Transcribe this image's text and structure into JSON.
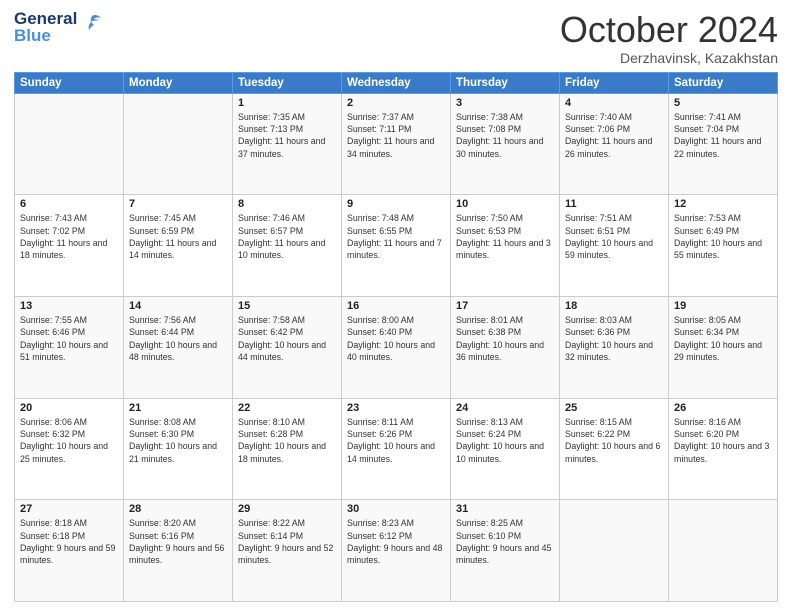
{
  "header": {
    "logo_line1": "General",
    "logo_line2": "Blue",
    "month_title": "October 2024",
    "location": "Derzhavinsk, Kazakhstan"
  },
  "weekdays": [
    "Sunday",
    "Monday",
    "Tuesday",
    "Wednesday",
    "Thursday",
    "Friday",
    "Saturday"
  ],
  "weeks": [
    [
      {
        "day": "",
        "info": ""
      },
      {
        "day": "",
        "info": ""
      },
      {
        "day": "1",
        "info": "Sunrise: 7:35 AM\nSunset: 7:13 PM\nDaylight: 11 hours and 37 minutes."
      },
      {
        "day": "2",
        "info": "Sunrise: 7:37 AM\nSunset: 7:11 PM\nDaylight: 11 hours and 34 minutes."
      },
      {
        "day": "3",
        "info": "Sunrise: 7:38 AM\nSunset: 7:08 PM\nDaylight: 11 hours and 30 minutes."
      },
      {
        "day": "4",
        "info": "Sunrise: 7:40 AM\nSunset: 7:06 PM\nDaylight: 11 hours and 26 minutes."
      },
      {
        "day": "5",
        "info": "Sunrise: 7:41 AM\nSunset: 7:04 PM\nDaylight: 11 hours and 22 minutes."
      }
    ],
    [
      {
        "day": "6",
        "info": "Sunrise: 7:43 AM\nSunset: 7:02 PM\nDaylight: 11 hours and 18 minutes."
      },
      {
        "day": "7",
        "info": "Sunrise: 7:45 AM\nSunset: 6:59 PM\nDaylight: 11 hours and 14 minutes."
      },
      {
        "day": "8",
        "info": "Sunrise: 7:46 AM\nSunset: 6:57 PM\nDaylight: 11 hours and 10 minutes."
      },
      {
        "day": "9",
        "info": "Sunrise: 7:48 AM\nSunset: 6:55 PM\nDaylight: 11 hours and 7 minutes."
      },
      {
        "day": "10",
        "info": "Sunrise: 7:50 AM\nSunset: 6:53 PM\nDaylight: 11 hours and 3 minutes."
      },
      {
        "day": "11",
        "info": "Sunrise: 7:51 AM\nSunset: 6:51 PM\nDaylight: 10 hours and 59 minutes."
      },
      {
        "day": "12",
        "info": "Sunrise: 7:53 AM\nSunset: 6:49 PM\nDaylight: 10 hours and 55 minutes."
      }
    ],
    [
      {
        "day": "13",
        "info": "Sunrise: 7:55 AM\nSunset: 6:46 PM\nDaylight: 10 hours and 51 minutes."
      },
      {
        "day": "14",
        "info": "Sunrise: 7:56 AM\nSunset: 6:44 PM\nDaylight: 10 hours and 48 minutes."
      },
      {
        "day": "15",
        "info": "Sunrise: 7:58 AM\nSunset: 6:42 PM\nDaylight: 10 hours and 44 minutes."
      },
      {
        "day": "16",
        "info": "Sunrise: 8:00 AM\nSunset: 6:40 PM\nDaylight: 10 hours and 40 minutes."
      },
      {
        "day": "17",
        "info": "Sunrise: 8:01 AM\nSunset: 6:38 PM\nDaylight: 10 hours and 36 minutes."
      },
      {
        "day": "18",
        "info": "Sunrise: 8:03 AM\nSunset: 6:36 PM\nDaylight: 10 hours and 32 minutes."
      },
      {
        "day": "19",
        "info": "Sunrise: 8:05 AM\nSunset: 6:34 PM\nDaylight: 10 hours and 29 minutes."
      }
    ],
    [
      {
        "day": "20",
        "info": "Sunrise: 8:06 AM\nSunset: 6:32 PM\nDaylight: 10 hours and 25 minutes."
      },
      {
        "day": "21",
        "info": "Sunrise: 8:08 AM\nSunset: 6:30 PM\nDaylight: 10 hours and 21 minutes."
      },
      {
        "day": "22",
        "info": "Sunrise: 8:10 AM\nSunset: 6:28 PM\nDaylight: 10 hours and 18 minutes."
      },
      {
        "day": "23",
        "info": "Sunrise: 8:11 AM\nSunset: 6:26 PM\nDaylight: 10 hours and 14 minutes."
      },
      {
        "day": "24",
        "info": "Sunrise: 8:13 AM\nSunset: 6:24 PM\nDaylight: 10 hours and 10 minutes."
      },
      {
        "day": "25",
        "info": "Sunrise: 8:15 AM\nSunset: 6:22 PM\nDaylight: 10 hours and 6 minutes."
      },
      {
        "day": "26",
        "info": "Sunrise: 8:16 AM\nSunset: 6:20 PM\nDaylight: 10 hours and 3 minutes."
      }
    ],
    [
      {
        "day": "27",
        "info": "Sunrise: 8:18 AM\nSunset: 6:18 PM\nDaylight: 9 hours and 59 minutes."
      },
      {
        "day": "28",
        "info": "Sunrise: 8:20 AM\nSunset: 6:16 PM\nDaylight: 9 hours and 56 minutes."
      },
      {
        "day": "29",
        "info": "Sunrise: 8:22 AM\nSunset: 6:14 PM\nDaylight: 9 hours and 52 minutes."
      },
      {
        "day": "30",
        "info": "Sunrise: 8:23 AM\nSunset: 6:12 PM\nDaylight: 9 hours and 48 minutes."
      },
      {
        "day": "31",
        "info": "Sunrise: 8:25 AM\nSunset: 6:10 PM\nDaylight: 9 hours and 45 minutes."
      },
      {
        "day": "",
        "info": ""
      },
      {
        "day": "",
        "info": ""
      }
    ]
  ]
}
